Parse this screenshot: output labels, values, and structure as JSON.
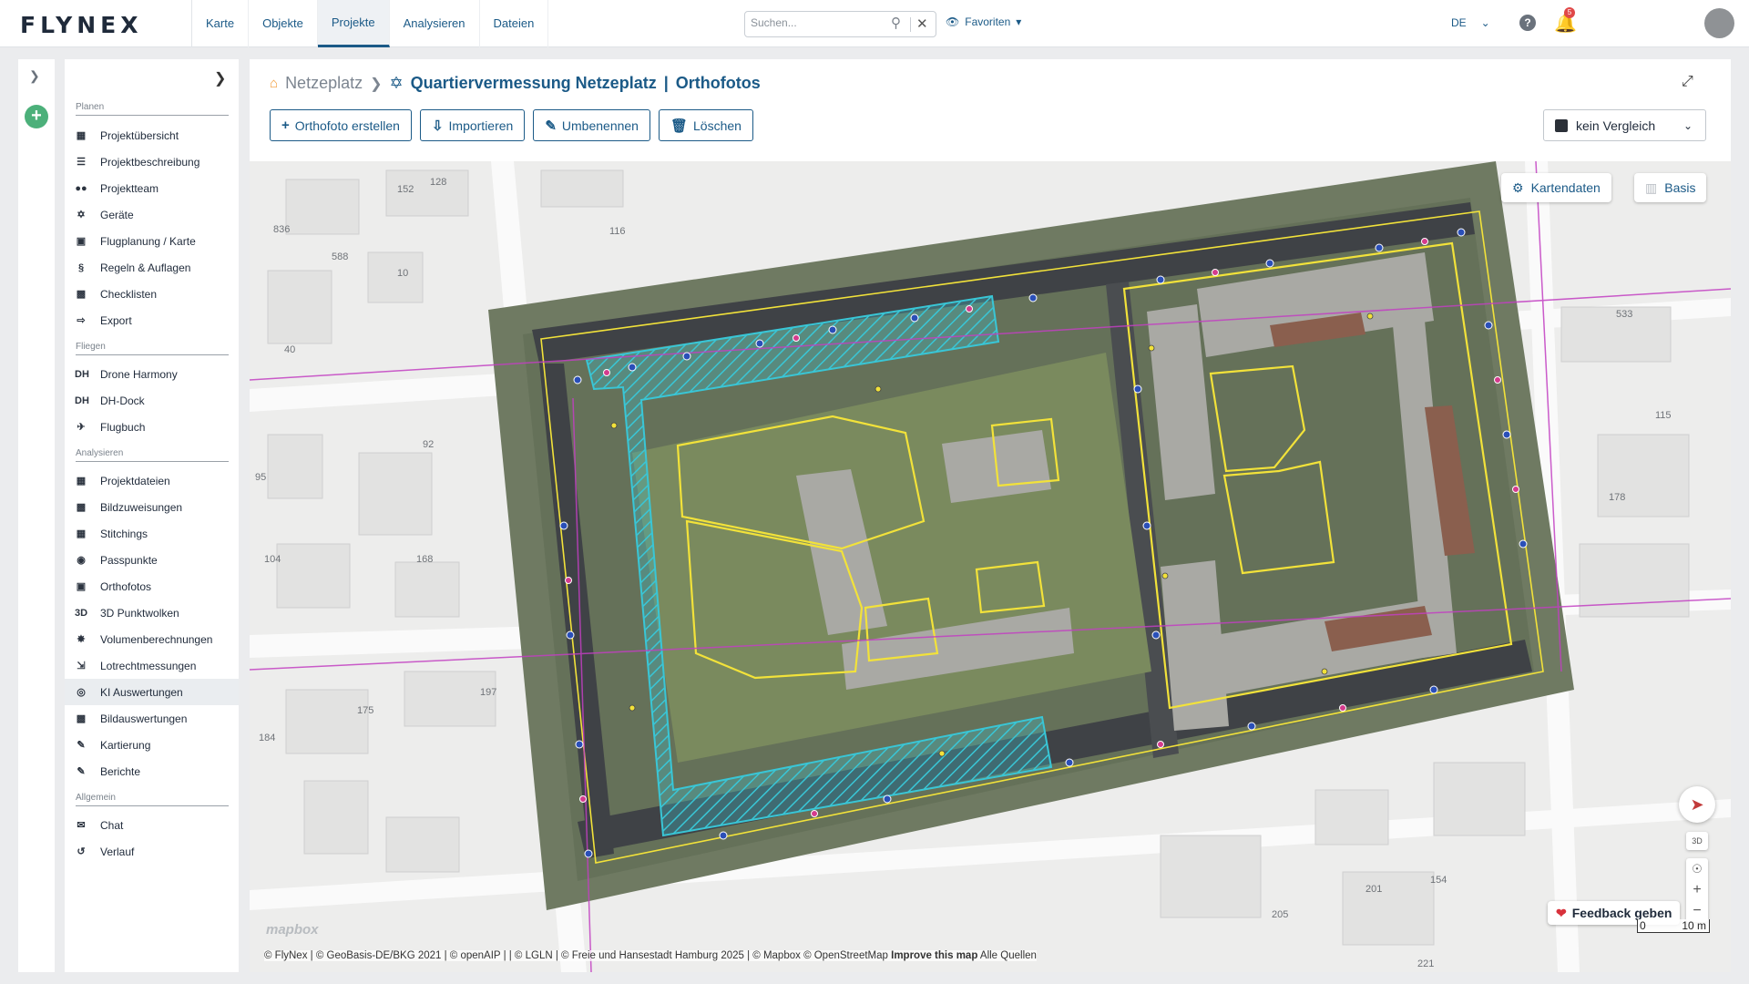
{
  "app": {
    "logo": "FLYNEX"
  },
  "nav": {
    "tabs": [
      "Karte",
      "Objekte",
      "Projekte",
      "Analysieren",
      "Dateien"
    ],
    "active": "Projekte"
  },
  "search": {
    "placeholder": "Suchen..."
  },
  "header": {
    "favorites": "Favoriten",
    "language": "DE",
    "notifications": "5"
  },
  "sidebar": {
    "sections": [
      {
        "title": "Planen",
        "items": [
          {
            "label": "Projektübersicht",
            "icon": "dashboard-icon"
          },
          {
            "label": "Projektbeschreibung",
            "icon": "list-icon"
          },
          {
            "label": "Projektteam",
            "icon": "team-icon"
          },
          {
            "label": "Geräte",
            "icon": "drone-icon"
          },
          {
            "label": "Flugplanung / Karte",
            "icon": "map-icon"
          },
          {
            "label": "Regeln & Auflagen",
            "icon": "paragraph-icon"
          },
          {
            "label": "Checklisten",
            "icon": "clipboard-icon"
          },
          {
            "label": "Export",
            "icon": "export-icon"
          }
        ]
      },
      {
        "title": "Fliegen",
        "items": [
          {
            "label": "Drone Harmony",
            "icon": "dh-icon"
          },
          {
            "label": "DH-Dock",
            "icon": "dh-dock-icon"
          },
          {
            "label": "Flugbuch",
            "icon": "plane-icon"
          }
        ]
      },
      {
        "title": "Analysieren",
        "items": [
          {
            "label": "Projektdateien",
            "icon": "image-folder-icon"
          },
          {
            "label": "Bildzuweisungen",
            "icon": "image-assign-icon"
          },
          {
            "label": "Stitchings",
            "icon": "stitch-icon"
          },
          {
            "label": "Passpunkte",
            "icon": "globe-icon"
          },
          {
            "label": "Orthofotos",
            "icon": "orthophoto-icon"
          },
          {
            "label": "3D Punktwolken",
            "icon": "3d-icon"
          },
          {
            "label": "Volumenberechnungen",
            "icon": "volume-icon"
          },
          {
            "label": "Lotrechtmessungen",
            "icon": "measure-icon"
          },
          {
            "label": "KI Auswertungen",
            "icon": "ai-icon"
          },
          {
            "label": "Bildauswertungen",
            "icon": "image-eval-icon"
          },
          {
            "label": "Kartierung",
            "icon": "mapping-icon"
          },
          {
            "label": "Berichte",
            "icon": "report-icon"
          }
        ]
      },
      {
        "title": "Allgemein",
        "items": [
          {
            "label": "Chat",
            "icon": "chat-icon"
          },
          {
            "label": "Verlauf",
            "icon": "history-icon"
          }
        ]
      }
    ],
    "active_item": "KI Auswertungen"
  },
  "breadcrumb": {
    "root": "Netzeplatz",
    "project": "Quartiervermessung Netzeplatz",
    "page": "Orthofotos",
    "separator": "|"
  },
  "toolbar": {
    "create_label": "Orthofoto erstellen",
    "import_label": "Importieren",
    "rename_label": "Umbenennen",
    "delete_label": "Löschen"
  },
  "compare": {
    "value": "kein Vergleich"
  },
  "map": {
    "kartendaten_label": "Kartendaten",
    "basis_label": "Basis",
    "feedback_label": "Feedback geben",
    "control_3d": "3D",
    "zoom_in": "+",
    "zoom_out": "−",
    "scale_start": "0",
    "scale_end": "10 m",
    "mapbox_logo": "mapbox",
    "attribution": "© FlyNex | © GeoBasis-DE/BKG 2021 | © openAIP | | © LGLN | © Freie und Hansestadt Hamburg 2025 | © Mapbox © OpenStreetMap",
    "improve": "Improve this map",
    "sources": "Alle Quellen",
    "parcel_labels": [
      "152",
      "128",
      "116",
      "836",
      "588",
      "10",
      "40",
      "92",
      "95",
      "104",
      "168",
      "175",
      "184",
      "197",
      "533",
      "115",
      "178",
      "154",
      "201",
      "205",
      "221"
    ],
    "colors": {
      "overlay_cyan": "#39c6d6",
      "overlay_yellow": "#f2e23a",
      "parcel_magenta": "#c23fc2",
      "accent": "#1b5a87"
    }
  }
}
